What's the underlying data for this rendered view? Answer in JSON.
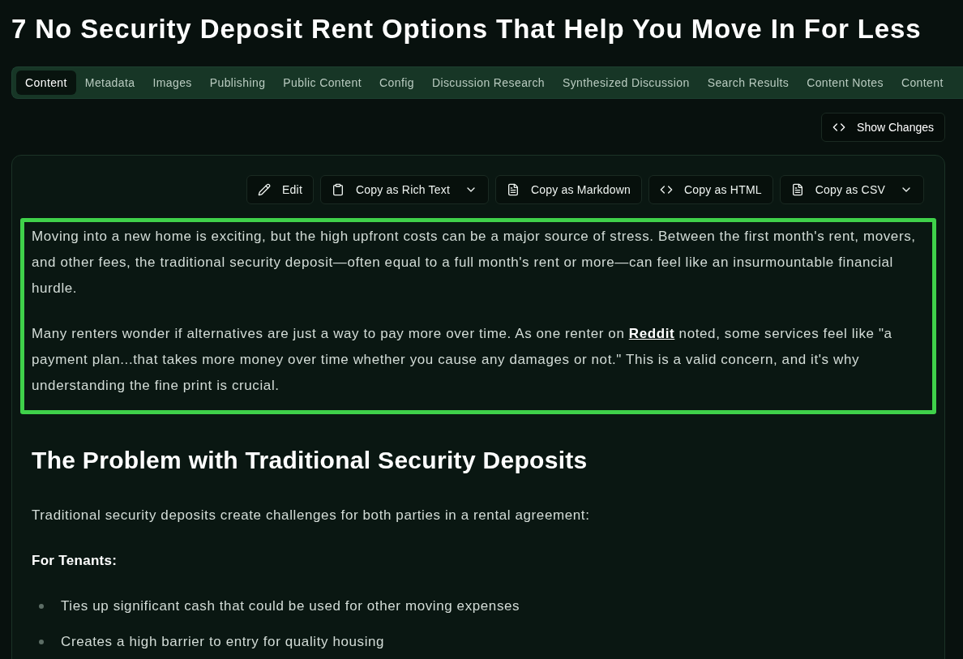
{
  "page": {
    "title": "7 No Security Deposit Rent Options That Help You Move In For Less"
  },
  "tabs": [
    {
      "label": "Content",
      "selected": true
    },
    {
      "label": "Metadata",
      "selected": false
    },
    {
      "label": "Images",
      "selected": false
    },
    {
      "label": "Publishing",
      "selected": false
    },
    {
      "label": "Public Content",
      "selected": false
    },
    {
      "label": "Config",
      "selected": false
    },
    {
      "label": "Discussion Research",
      "selected": false
    },
    {
      "label": "Synthesized Discussion",
      "selected": false
    },
    {
      "label": "Search Results",
      "selected": false
    },
    {
      "label": "Content Notes",
      "selected": false
    },
    {
      "label": "Content",
      "selected": false
    }
  ],
  "show_changes_button": {
    "label": "Show Changes"
  },
  "toolbar": [
    {
      "kind": "edit",
      "label": "Edit",
      "has_menu": false
    },
    {
      "kind": "clipboard",
      "label": "Copy as Rich Text",
      "has_menu": true
    },
    {
      "kind": "document",
      "label": "Copy as Markdown",
      "has_menu": false
    },
    {
      "kind": "code",
      "label": "Copy as HTML",
      "has_menu": false
    },
    {
      "kind": "document",
      "label": "Copy as CSV",
      "has_menu": true
    }
  ],
  "article": {
    "intro": {
      "highlighted": true,
      "paragraphs": [
        {
          "text": "Moving into a new home is exciting, but the high upfront costs can be a major source of stress. Between the first month's rent, movers, and other fees, the traditional security deposit—often equal to a full month's rent or more—can feel like an insurmountable financial hurdle."
        },
        {
          "text": "Many renters wonder if alternatives are just a way to pay more over time. As one renter on ",
          "link": "Reddit",
          "text_after": " noted, some services feel like \"a payment plan...that takes more money over time whether you cause any damages or not.\" This is a valid concern, and it's why understanding the fine print is crucial."
        }
      ]
    },
    "blocks": [
      {
        "kind": "heading",
        "text": "The Problem with Traditional Security Deposits"
      },
      {
        "kind": "paragraph",
        "text": "Traditional security deposits create challenges for both parties in a rental agreement:"
      },
      {
        "kind": "subheading",
        "text": "For Tenants:"
      },
      {
        "kind": "bullets",
        "items": [
          "Ties up significant cash that could be used for other moving expenses",
          "Creates a high barrier to entry for quality housing"
        ]
      }
    ]
  }
}
